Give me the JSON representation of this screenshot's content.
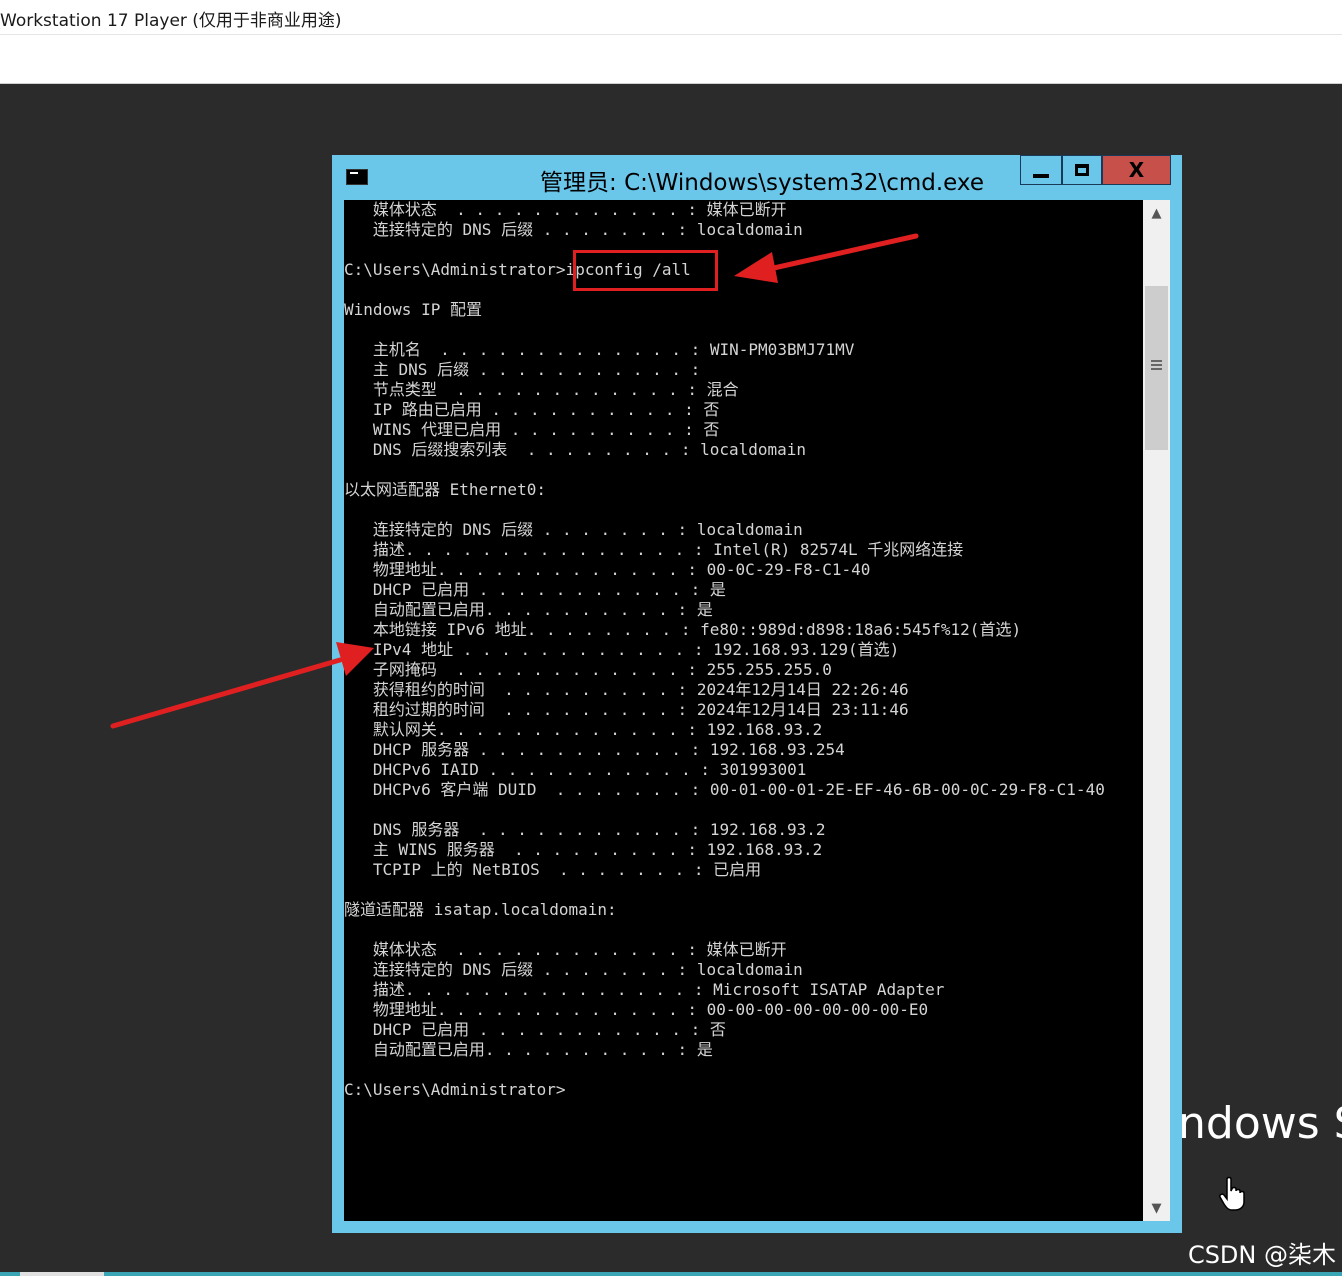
{
  "vm_window": {
    "title": "Workstation 17 Player (仅用于非商业用途)"
  },
  "cmd": {
    "title": "管理员: C:\\Windows\\system32\\cmd.exe",
    "icon": "console-icon",
    "buttons": {
      "minimize": "minimize-icon",
      "maximize": "maximize-icon",
      "close": "X"
    },
    "lines": [
      "   媒体状态  . . . . . . . . . . . . : 媒体已断开",
      "   连接特定的 DNS 后缀 . . . . . . . : localdomain",
      "",
      "C:\\Users\\Administrator>ipconfig /all",
      "",
      "Windows IP 配置",
      "",
      "   主机名  . . . . . . . . . . . . . : WIN-PM03BMJ71MV",
      "   主 DNS 后缀 . . . . . . . . . . . :",
      "   节点类型  . . . . . . . . . . . . : 混合",
      "   IP 路由已启用 . . . . . . . . . . : 否",
      "   WINS 代理已启用 . . . . . . . . . : 否",
      "   DNS 后缀搜索列表  . . . . . . . . : localdomain",
      "",
      "以太网适配器 Ethernet0:",
      "",
      "   连接特定的 DNS 后缀 . . . . . . . : localdomain",
      "   描述. . . . . . . . . . . . . . . : Intel(R) 82574L 千兆网络连接",
      "   物理地址. . . . . . . . . . . . . : 00-0C-29-F8-C1-40",
      "   DHCP 已启用 . . . . . . . . . . . : 是",
      "   自动配置已启用. . . . . . . . . . : 是",
      "   本地链接 IPv6 地址. . . . . . . . : fe80::989d:d898:18a6:545f%12(首选)",
      "   IPv4 地址 . . . . . . . . . . . . : 192.168.93.129(首选)",
      "   子网掩码  . . . . . . . . . . . . : 255.255.255.0",
      "   获得租约的时间  . . . . . . . . . : 2024年12月14日 22:26:46",
      "   租约过期的时间  . . . . . . . . . : 2024年12月14日 23:11:46",
      "   默认网关. . . . . . . . . . . . . : 192.168.93.2",
      "   DHCP 服务器 . . . . . . . . . . . : 192.168.93.254",
      "   DHCPv6 IAID . . . . . . . . . . . : 301993001",
      "   DHCPv6 客户端 DUID  . . . . . . . : 00-01-00-01-2E-EF-46-6B-00-0C-29-F8-C1-40",
      "",
      "   DNS 服务器  . . . . . . . . . . . : 192.168.93.2",
      "   主 WINS 服务器  . . . . . . . . . : 192.168.93.2",
      "   TCPIP 上的 NetBIOS  . . . . . . . : 已启用",
      "",
      "隧道适配器 isatap.localdomain:",
      "",
      "   媒体状态  . . . . . . . . . . . . : 媒体已断开",
      "   连接特定的 DNS 后缀 . . . . . . . : localdomain",
      "   描述. . . . . . . . . . . . . . . : Microsoft ISATAP Adapter",
      "   物理地址. . . . . . . . . . . . . : 00-00-00-00-00-00-00-E0",
      "   DHCP 已启用 . . . . . . . . . . . : 否",
      "   自动配置已启用. . . . . . . . . . : 是",
      "",
      "C:\\Users\\Administrator>"
    ]
  },
  "desktop": {
    "watermark_partial": "ndows S",
    "cursor_icon": "hand-pointer-icon"
  },
  "annotations": {
    "arrow_color": "#e02020",
    "highlight_color": "#e02020"
  },
  "credit": "CSDN @柒木"
}
